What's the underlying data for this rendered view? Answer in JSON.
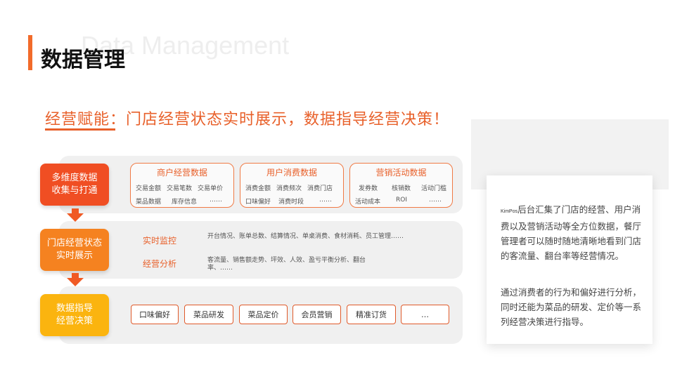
{
  "header": {
    "title": "数据管理",
    "watermark": "Data Management"
  },
  "headline": "经营赋能：门店经营状态实时展示，数据指导经营决策！",
  "stages": [
    {
      "line1": "多维度数据",
      "line2": "收集与打通",
      "color": "#f04e23"
    },
    {
      "line1": "门店经营状态",
      "line2": "实时展示",
      "color": "#f58220"
    },
    {
      "line1": "数据指导",
      "line2": "经营决策",
      "color": "#fbb40f"
    }
  ],
  "data_boxes": [
    {
      "title": "商户经营数据",
      "items": [
        "交易金额",
        "交易笔数",
        "交易单价",
        "菜品数据",
        "库存信息",
        "……"
      ]
    },
    {
      "title": "用户消费数据",
      "items": [
        "消费金额",
        "消费频次",
        "消费门店",
        "口味偏好",
        "消费时段",
        "……"
      ]
    },
    {
      "title": "营销活动数据",
      "items": [
        "发券数",
        "核销数",
        "活动门槛",
        "活动成本",
        "ROI",
        "……"
      ]
    }
  ],
  "monitor": {
    "realtime_label": "实时监控",
    "realtime_text": "开台情况、账单总数、结算情况、单桌消费、食材消耗、员工管理……",
    "analysis_label": "经营分析",
    "analysis_text": "客流量、销售额走势、坪效、人效、盈亏平衡分析、翻台率、……"
  },
  "decisions": [
    "口味偏好",
    "菜品研发",
    "菜品定价",
    "会员营销",
    "精准订货",
    "…"
  ],
  "card": {
    "brand": "KimPos",
    "para1": "后台汇集了门店的经营、用户消费以及营销活动等全方位数据，餐厅管理者可以随时随地清晰地看到门店的客流量、翻台率等经营情况。",
    "para2": "通过消费者的行为和偏好进行分析，同时还能为菜品的研发、定价等一系列经营决策进行指导。"
  },
  "colors": {
    "accent": "#f26b2a",
    "stage1": "#f04e23",
    "stage2": "#f58220",
    "stage3": "#fbb40f"
  }
}
